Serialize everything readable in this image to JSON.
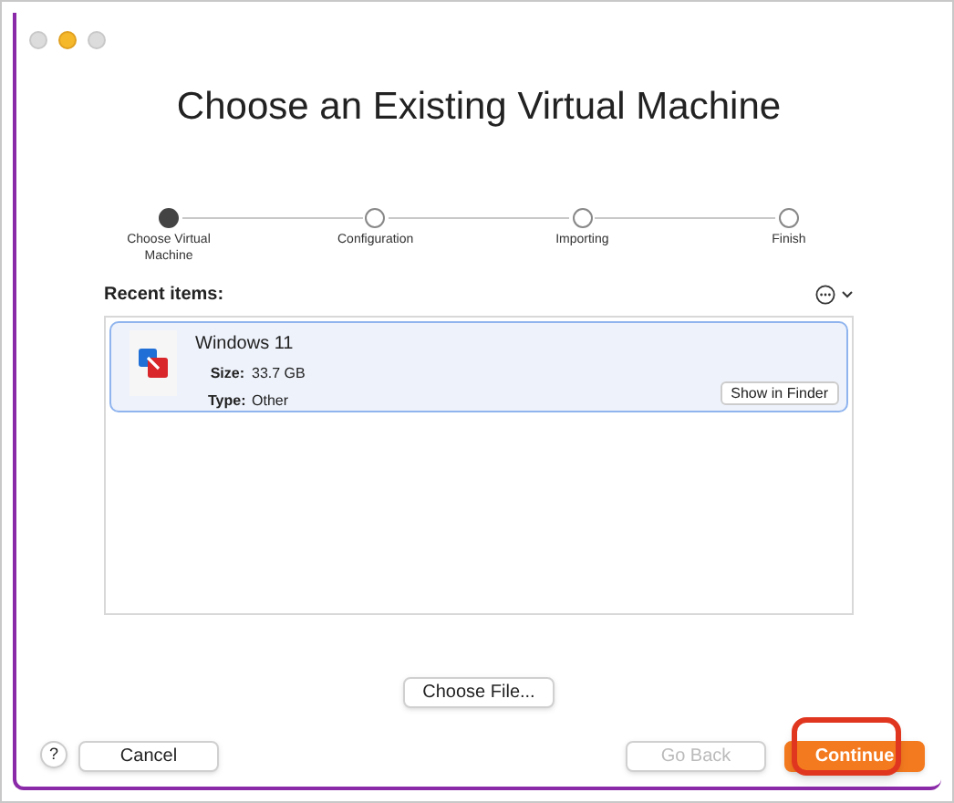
{
  "window": {
    "title": "Choose an Existing Virtual Machine"
  },
  "steps": [
    {
      "label": "Choose Virtual Machine",
      "selected": true
    },
    {
      "label": "Configuration",
      "selected": false
    },
    {
      "label": "Importing",
      "selected": false
    },
    {
      "label": "Finish",
      "selected": false
    }
  ],
  "recent": {
    "label": "Recent items:",
    "items": [
      {
        "name": "Windows 11",
        "size_label": "Size:",
        "size": "33.7 GB",
        "type_label": "Type:",
        "type": "Other",
        "action": "Show in Finder",
        "selected": true
      }
    ]
  },
  "choose_file": "Choose File...",
  "help": "?",
  "buttons": [
    {
      "label": "Cancel",
      "kind": "plain",
      "disabled": false
    },
    {
      "label": "Go Back",
      "kind": "plain",
      "disabled": true
    },
    {
      "label": "Continue",
      "kind": "default",
      "disabled": false,
      "highlighted": true
    }
  ]
}
